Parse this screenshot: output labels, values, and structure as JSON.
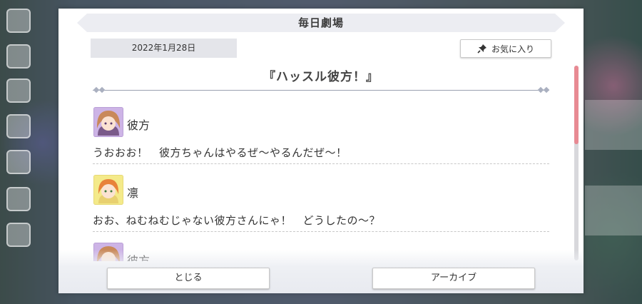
{
  "header": {
    "title": "毎日劇場"
  },
  "date": "2022年1月28日",
  "favorite_button": {
    "label": "お気に入り",
    "icon": "pin-icon"
  },
  "story_title": "『ハッスル彼方！』",
  "dialogue": [
    {
      "speaker": "彼方",
      "line": "うおおお！　彼方ちゃんはやるぜ〜やるんだぜ〜！",
      "avatar": "kanata-avatar"
    },
    {
      "speaker": "凛",
      "line": "おお、ねむねむじゃない彼方さんにゃ！　どうしたの〜？",
      "avatar": "rin-avatar"
    },
    {
      "speaker": "彼方",
      "line": "",
      "avatar": "kanata-avatar"
    }
  ],
  "buttons": {
    "close": "とじる",
    "archive": "アーカイブ"
  },
  "colors": {
    "scroll_thumb": "#e88a93",
    "kanata_avatar_bg": "#cdb4e6",
    "rin_avatar_bg": "#f4ea8a"
  }
}
